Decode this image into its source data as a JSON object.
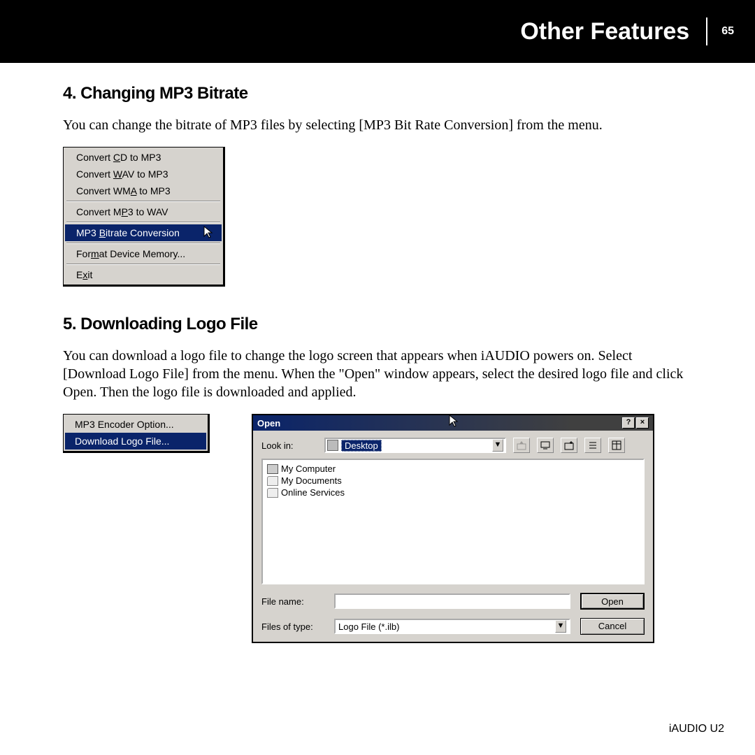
{
  "header": {
    "title": "Other Features",
    "page": "65"
  },
  "section4": {
    "heading": "4. Changing MP3 Bitrate",
    "body": "You can change the bitrate of MP3 files by selecting [MP3 Bit Rate Conversion] from the menu."
  },
  "menu1": {
    "items": [
      "Convert CD to MP3",
      "Convert WAV to MP3",
      "Convert WMA to MP3",
      "Convert MP3 to WAV",
      "MP3 Bitrate Conversion",
      "Format Device Memory...",
      "Exit"
    ]
  },
  "section5": {
    "heading": "5. Downloading Logo File",
    "body": "You can download a logo file to change the logo screen that appears when iAUDIO powers on. Select [Download Logo File] from the menu. When the \"Open\" window appears, select the desired logo file and click Open. Then the logo file is downloaded and applied."
  },
  "menu2": {
    "items": [
      "MP3 Encoder Option...",
      "Download Logo File..."
    ]
  },
  "dialog": {
    "title": "Open",
    "lookin_label": "Look in:",
    "lookin_value": "Desktop",
    "filelist": [
      "My Computer",
      "My Documents",
      "Online Services"
    ],
    "filename_label": "File name:",
    "filename_value": "",
    "filetype_label": "Files of type:",
    "filetype_value": "Logo File (*.ilb)",
    "open_btn": "Open",
    "cancel_btn": "Cancel",
    "help_btn": "?",
    "close_btn": "×"
  },
  "footer": "iAUDIO U2"
}
